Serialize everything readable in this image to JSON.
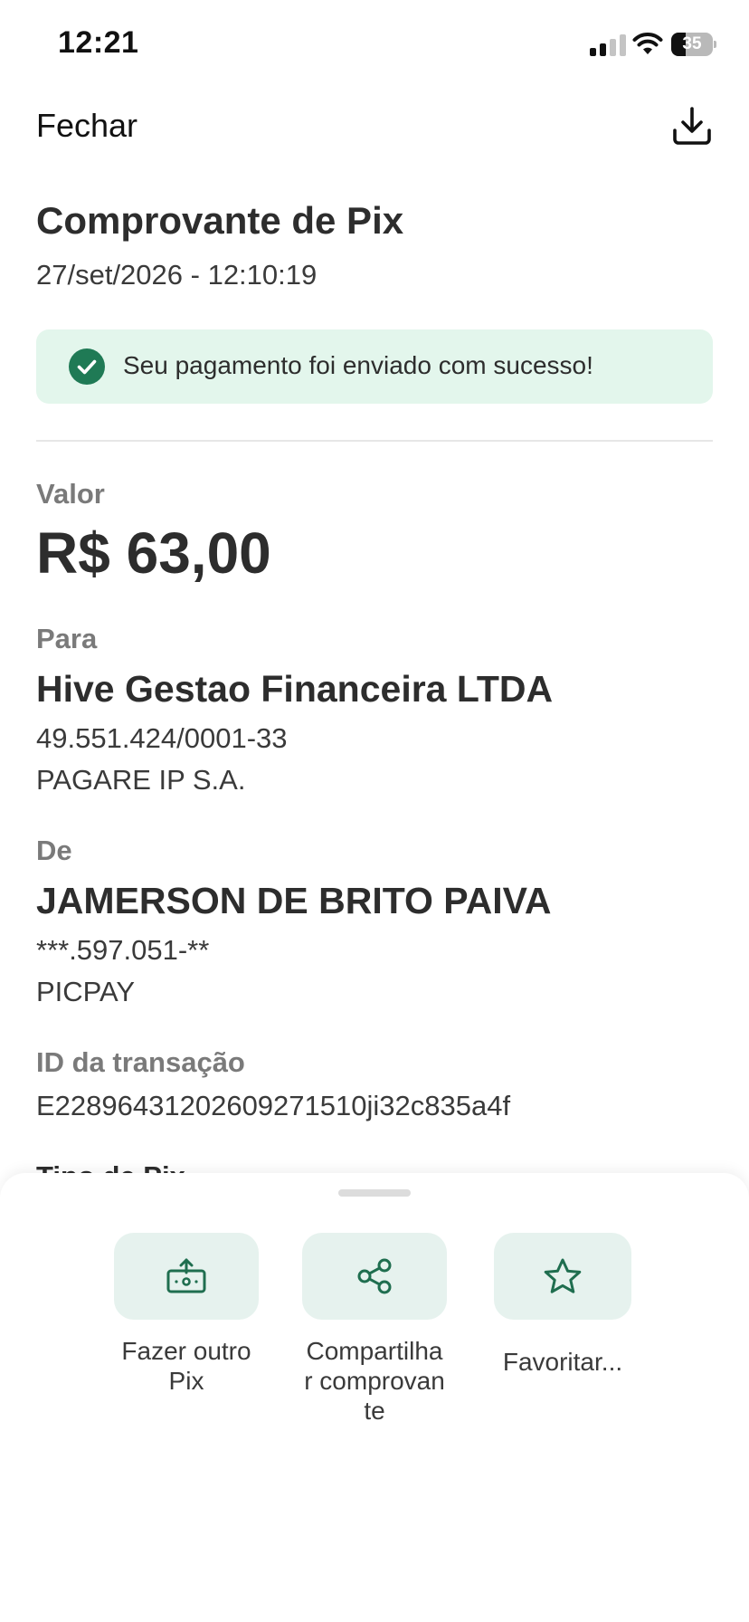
{
  "status_bar": {
    "time": "12:21",
    "battery": "35",
    "battery_level": 0.35
  },
  "header": {
    "close_label": "Fechar",
    "download_icon": "download-icon"
  },
  "receipt": {
    "title": "Comprovante de Pix",
    "datetime": "27/set/2026 - 12:10:19",
    "success_message": "Seu pagamento foi enviado com sucesso!",
    "valor_label": "Valor",
    "valor": "R$ 63,00",
    "para_label": "Para",
    "para_name": "Hive Gestao Financeira LTDA",
    "para_doc": "49.551.424/0001-33",
    "para_institution": "PAGARE IP S.A.",
    "de_label": "De",
    "de_name": "JAMERSON DE BRITO PAIVA",
    "de_doc": "***.597.051-**",
    "de_institution": "PICPAY",
    "id_label": "ID da transação",
    "id_value": "E22896431202609271510ji32c835a4f",
    "next_section_partial": "Tipo de Pix"
  },
  "actions": [
    {
      "label": "Fazer outro Pix",
      "icon": "money-upload-icon"
    },
    {
      "label": "Compartilhar comprovante",
      "icon": "share-icon"
    },
    {
      "label": "Favoritar...",
      "icon": "star-icon"
    }
  ],
  "colors": {
    "accent": "#1f6e4f",
    "success_bg": "#e3f6ec",
    "action_bg": "#e6f2ee",
    "label_gray": "#7a7a7a"
  }
}
